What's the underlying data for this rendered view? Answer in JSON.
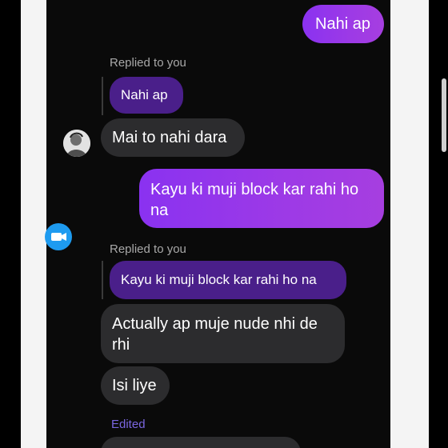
{
  "messages": {
    "m1": "Nahi ap",
    "reply1_label": "Replied to you",
    "reply1_quote": "Nahi ap",
    "m2": "Mai to nahi dara",
    "m3": "Kayu ki muji block kar rahi ho na",
    "reply2_label": "Replied to you",
    "reply2_quote": "Kayu ki muji block kar rahi ho na",
    "m4": "Actually ap muje nude nhi de rhi",
    "m5": "Isi liye",
    "edited_label": "Edited"
  },
  "icons": {
    "avatar": "profile-avatar",
    "video": "video-call-icon"
  },
  "colors": {
    "outgoing": "#9a38e8",
    "incoming": "#2c2c2e",
    "quoted": "#4a1f8a",
    "edited": "#7a66e0"
  }
}
